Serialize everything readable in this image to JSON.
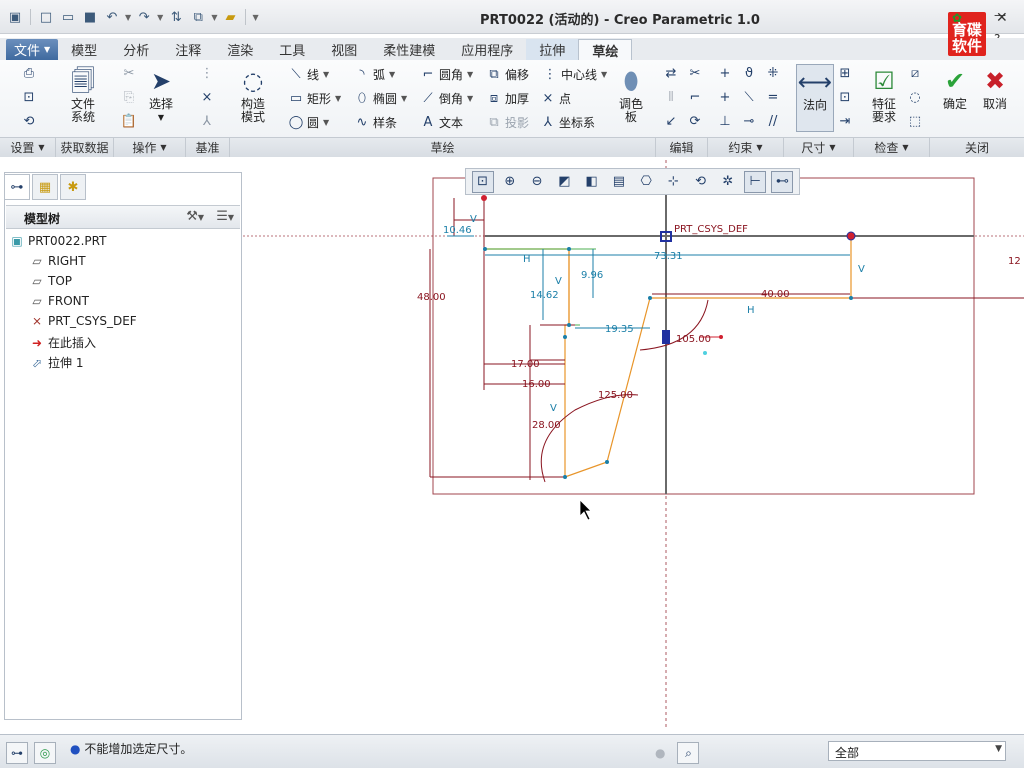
{
  "window": {
    "title": "PRT0022 (活动的) - Creo Parametric 1.0"
  },
  "logo": {
    "text": "育碟\n软件"
  },
  "tabs": [
    {
      "label": "文件"
    },
    {
      "label": "模型"
    },
    {
      "label": "分析"
    },
    {
      "label": "注释"
    },
    {
      "label": "渲染"
    },
    {
      "label": "工具"
    },
    {
      "label": "视图"
    },
    {
      "label": "柔性建模"
    },
    {
      "label": "应用程序"
    },
    {
      "label": "拉伸"
    },
    {
      "label": "草绘"
    }
  ],
  "ribbon": {
    "file_system": "文件\n系统",
    "select": "选择",
    "construction_mode": "构造\n模式",
    "line": "线",
    "arc": "弧",
    "fillet": "圆角",
    "offset": "偏移",
    "centerline": "中心线",
    "rectangle": "矩形",
    "ellipse": "椭圆",
    "chamfer": "倒角",
    "thicken": "加厚",
    "point": "点",
    "circle": "圆",
    "spline": "样条",
    "text": "文本",
    "project": "投影",
    "coord_system": "坐标系",
    "palette": "调色\n板",
    "normal": "法向",
    "feature_req": "特征\n要求",
    "ok": "确定",
    "cancel": "取消"
  },
  "groups": [
    {
      "label": "设置"
    },
    {
      "label": "获取数据"
    },
    {
      "label": "操作"
    },
    {
      "label": "基准"
    },
    {
      "label": "草绘"
    },
    {
      "label": "编辑"
    },
    {
      "label": "约束"
    },
    {
      "label": "尺寸"
    },
    {
      "label": "检查"
    },
    {
      "label": "关闭"
    }
  ],
  "model_tree": {
    "title": "模型树",
    "items": [
      {
        "label": "PRT0022.PRT"
      },
      {
        "label": "RIGHT"
      },
      {
        "label": "TOP"
      },
      {
        "label": "FRONT"
      },
      {
        "label": "PRT_CSYS_DEF"
      },
      {
        "label": "在此插入"
      },
      {
        "label": "拉伸 1"
      }
    ]
  },
  "sketch": {
    "csys_label": "PRT_CSYS_DEF",
    "dims": {
      "d_10_46": "10.46",
      "d_73_31": "73.31",
      "d_9_96": "9.96",
      "d_14_62": "14.62",
      "d_40": "40.00",
      "d_48": "48.00",
      "d_19_35": "19.35",
      "d_105": "105.00",
      "d_17": "17.00",
      "d_16": "16.00",
      "d_125": "125.00",
      "d_28": "28.00",
      "d_12": "12"
    },
    "constraints": {
      "v": "V",
      "h": "H"
    }
  },
  "status": {
    "message": "不能增加选定尺寸。",
    "filter": "全部"
  },
  "colors": {
    "sketch_line": "#e8952a",
    "dimension": "#1b7fa8",
    "strong_dim": "#8a1520",
    "reference": "#8a1520"
  }
}
